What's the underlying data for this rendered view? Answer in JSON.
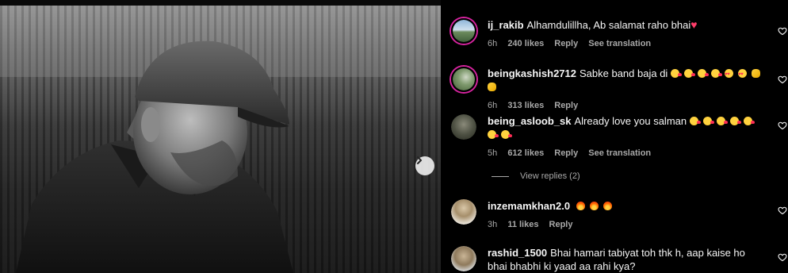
{
  "comments": [
    {
      "username": "ij_rakib",
      "text": "Alhamdulillha, Ab salamat raho bhai",
      "emoji": [
        "pink-heart"
      ],
      "time": "6h",
      "likes": "240 likes",
      "reply": "Reply",
      "translation": "See translation"
    },
    {
      "username": "beingkashish2712",
      "text": "Sabke band baja di",
      "emoji": [
        "laughing-face",
        "laughing-face",
        "laughing-face",
        "laughing-face",
        "heart-eyes-face",
        "heart-eyes-face",
        "clapping-hands",
        "clapping-hands"
      ],
      "time": "6h",
      "likes": "313 likes",
      "reply": "Reply"
    },
    {
      "username": "being_asloob_sk",
      "text": "Already love you salman",
      "emoji": [
        "kiss-face",
        "kiss-face",
        "kiss-face",
        "kiss-face",
        "kiss-face",
        "kiss-face",
        "kiss-face"
      ],
      "time": "5h",
      "likes": "612 likes",
      "reply": "Reply",
      "translation": "See translation"
    },
    {
      "username": "inzemamkhan2.0",
      "text": "",
      "emoji": [
        "fire",
        "fire",
        "fire"
      ],
      "time": "3h",
      "likes": "11 likes",
      "reply": "Reply"
    },
    {
      "username": "rashid_1500",
      "text": "Bhai hamari tabiyat toh thk h, aap kaise ho bhai bhabhi ki yaad aa rahi kya?",
      "time": "",
      "likes": "",
      "reply": ""
    }
  ],
  "view_replies": "View replies (2)",
  "colors": {
    "background": "#000000",
    "text": "#f5f5f5",
    "secondary": "#a8a8a8",
    "story_ring": "#d6249f",
    "heart_emoji": "#ff3d6a"
  }
}
